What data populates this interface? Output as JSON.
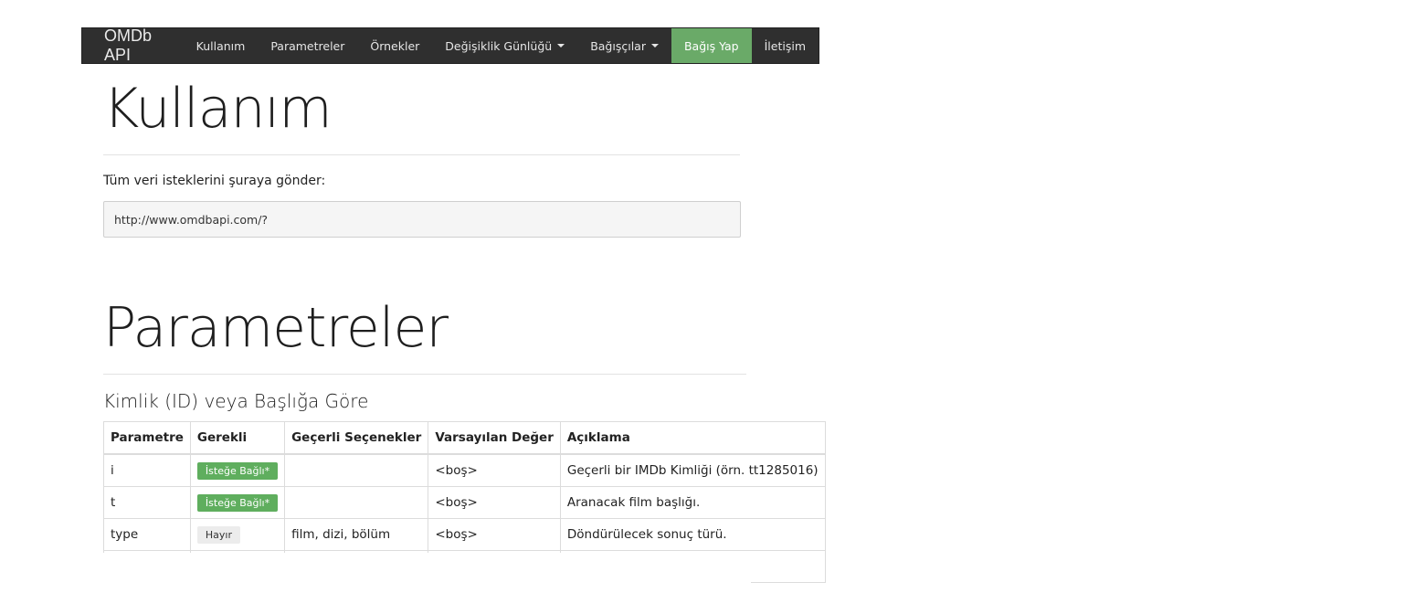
{
  "navbar": {
    "brand": "OMDb API",
    "items": [
      {
        "label": "Kullanım",
        "dropdown": false,
        "active": false
      },
      {
        "label": "Parametreler",
        "dropdown": false,
        "active": false
      },
      {
        "label": "Örnekler",
        "dropdown": false,
        "active": false
      },
      {
        "label": "Değişiklik Günlüğü",
        "dropdown": true,
        "active": false
      },
      {
        "label": "Bağışçılar",
        "dropdown": true,
        "active": false
      },
      {
        "label": "Bağış Yap",
        "dropdown": false,
        "active": true
      },
      {
        "label": "İletişim",
        "dropdown": false,
        "active": false
      }
    ],
    "active_color": "#6aaa68",
    "background_color": "#2f2f2f"
  },
  "usage": {
    "title": "Kullanım",
    "lead": "Tüm veri isteklerini şuraya gönder:",
    "url": "http://www.omdbapi.com/?"
  },
  "parameters": {
    "title": "Parametreler",
    "subtitle": "Kimlik (ID) veya Başlığa Göre",
    "table": {
      "headers": [
        "Parametre",
        "Gerekli",
        "Geçerli Seçenekler",
        "Varsayılan Değer",
        "Açıklama"
      ],
      "rows": [
        {
          "param": "i",
          "required": "İsteğe Bağlı*",
          "required_style": "green",
          "options": "",
          "default": "<boş>",
          "description": "Geçerli bir IMDb Kimliği (örn. tt1285016)"
        },
        {
          "param": "t",
          "required": "İsteğe Bağlı*",
          "required_style": "green",
          "options": "",
          "default": "<boş>",
          "description": "Aranacak film başlığı."
        },
        {
          "param": "type",
          "required": "Hayır",
          "required_style": "gray",
          "options": "film, dizi, bölüm",
          "default": "<boş>",
          "description": "Döndürülecek sonuç türü."
        }
      ]
    }
  }
}
